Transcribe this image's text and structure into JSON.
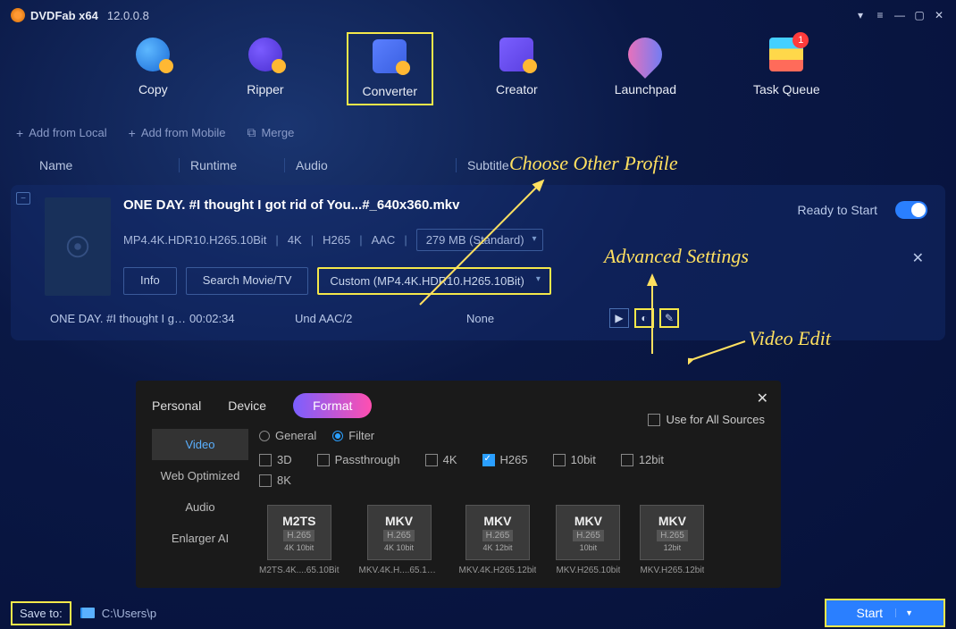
{
  "titlebar": {
    "app_name": "DVDFab x64",
    "version": "12.0.0.8"
  },
  "modules": {
    "copy": "Copy",
    "ripper": "Ripper",
    "converter": "Converter",
    "creator": "Creator",
    "launchpad": "Launchpad",
    "taskqueue": "Task Queue",
    "taskqueue_badge": "1"
  },
  "actionbar": {
    "add_local": "Add from Local",
    "add_mobile": "Add from Mobile",
    "merge": "Merge"
  },
  "columns": {
    "name": "Name",
    "runtime": "Runtime",
    "audio": "Audio",
    "subtitle": "Subtitle"
  },
  "file": {
    "title": "ONE DAY. #I thought I got rid of You...#_640x360.mkv",
    "short_name": "ONE DAY. #I thought I got...",
    "runtime": "00:02:34",
    "audio_track": "Und  AAC/2",
    "subtitle_track": "None",
    "meta": {
      "format": "MP4.4K.HDR10.H265.10Bit",
      "res": "4K",
      "codec": "H265",
      "audio": "AAC",
      "size": "279 MB (Standard)"
    },
    "btn_info": "Info",
    "btn_search": "Search Movie/TV",
    "profile": "Custom (MP4.4K.HDR10.H265.10Bit)",
    "status": "Ready to Start"
  },
  "popup": {
    "tabs": {
      "personal": "Personal",
      "device": "Device",
      "format": "Format"
    },
    "use_all": "Use for All Sources",
    "side": {
      "video": "Video",
      "web": "Web Optimized",
      "audio": "Audio",
      "enlarger": "Enlarger AI"
    },
    "radios": {
      "general": "General",
      "filter": "Filter"
    },
    "filters": {
      "f3d": "3D",
      "fpass": "Passthrough",
      "f4k": "4K",
      "fh265": "H265",
      "f10": "10bit",
      "f12": "12bit",
      "f8k": "8K"
    },
    "profiles": [
      {
        "fmt": "M2TS",
        "codec": "H.265",
        "sub": "4K 10bit",
        "label": "M2TS.4K....65.10Bit"
      },
      {
        "fmt": "MKV",
        "codec": "H.265",
        "sub": "4K 10bit",
        "label": "MKV.4K.H....65.10Bit"
      },
      {
        "fmt": "MKV",
        "codec": "H.265",
        "sub": "4K 12bit",
        "label": "MKV.4K.H265.12bit"
      },
      {
        "fmt": "MKV",
        "codec": "H.265",
        "sub": "10bit",
        "label": "MKV.H265.10bit"
      },
      {
        "fmt": "MKV",
        "codec": "H.265",
        "sub": "12bit",
        "label": "MKV.H265.12bit"
      }
    ]
  },
  "bottom": {
    "saveto_label": "Save to:",
    "path": "C:\\Users\\p",
    "start": "Start"
  },
  "annotations": {
    "choose_profile": "Choose Other Profile",
    "advanced": "Advanced Settings",
    "video_edit": "Video Edit"
  }
}
